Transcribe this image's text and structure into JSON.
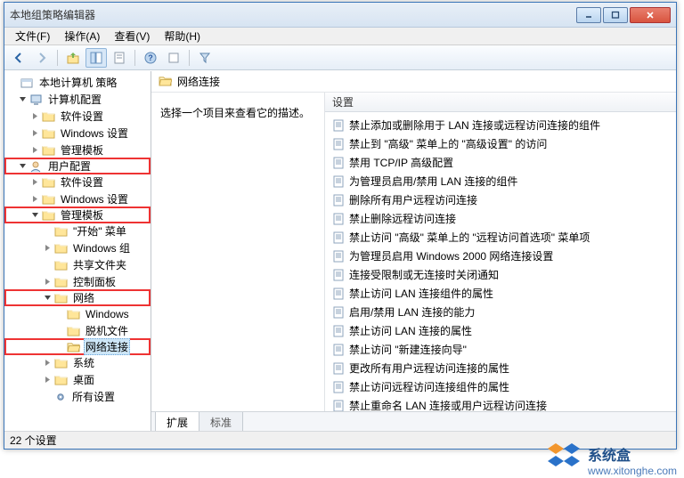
{
  "window": {
    "title": "本地组策略编辑器"
  },
  "menu": {
    "file": "文件(F)",
    "action": "操作(A)",
    "view": "查看(V)",
    "help": "帮助(H)"
  },
  "tree": {
    "root": "本地计算机 策略",
    "computer_config": "计算机配置",
    "cc_software": "软件设置",
    "cc_windows": "Windows 设置",
    "cc_admin": "管理模板",
    "user_config": "用户配置",
    "uc_software": "软件设置",
    "uc_windows": "Windows 设置",
    "uc_admin": "管理模板",
    "start_menu": "\"开始\" 菜单",
    "windows_components": "Windows 组",
    "shared_folders": "共享文件夹",
    "control_panel": "控制面板",
    "network": "网络",
    "net_windows": "Windows",
    "net_offline": "脱机文件",
    "net_connections": "网络连接",
    "system": "系统",
    "desktop": "桌面",
    "all_settings": "所有设置"
  },
  "right": {
    "header": "网络连接",
    "description": "选择一个项目来查看它的描述。",
    "column": "设置"
  },
  "items": [
    "禁止添加或删除用于 LAN 连接或远程访问连接的组件",
    "禁止到 \"高级\" 菜单上的 \"高级设置\" 的访问",
    "禁用 TCP/IP 高级配置",
    "为管理员启用/禁用 LAN 连接的组件",
    "删除所有用户远程访问连接",
    "禁止删除远程访问连接",
    "禁止访问 \"高级\" 菜单上的 \"远程访问首选项\" 菜单项",
    "为管理员启用 Windows 2000 网络连接设置",
    "连接受限制或无连接时关闭通知",
    "禁止访问 LAN 连接组件的属性",
    "启用/禁用 LAN 连接的能力",
    "禁止访问 LAN 连接的属性",
    "禁止访问 \"新建连接向导\"",
    "更改所有用户远程访问连接的属性",
    "禁止访问远程访问连接组件的属性",
    "禁止重命名 LAN 连接或用户远程访问连接"
  ],
  "tabs": {
    "extended": "扩展",
    "standard": "标准"
  },
  "status": "22 个设置",
  "watermark": {
    "text": "系统盒",
    "url": "www.xitonghe.com"
  }
}
